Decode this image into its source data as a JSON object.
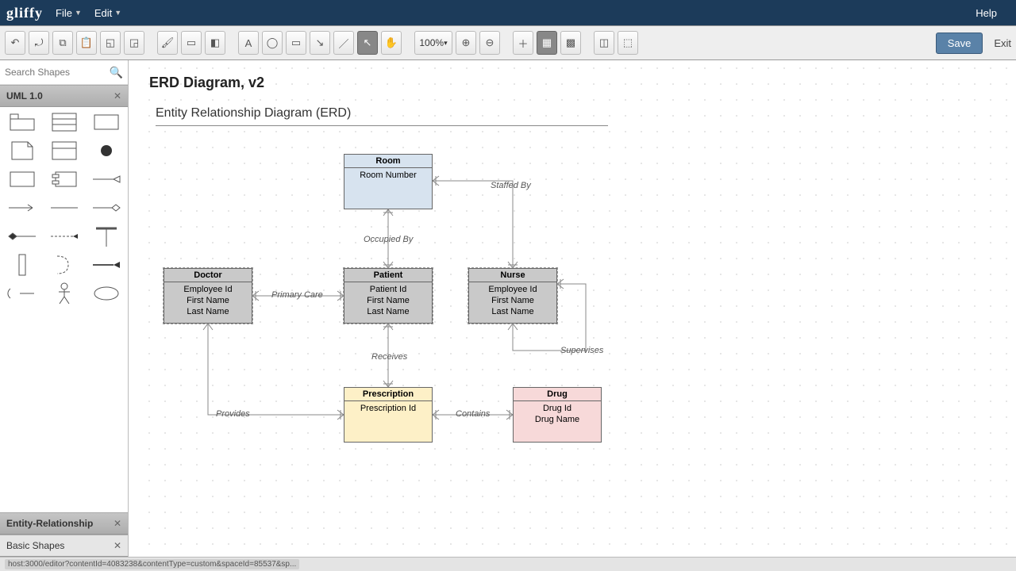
{
  "menubar": {
    "logo": "gliffy",
    "file": "File",
    "edit": "Edit",
    "help": "Help"
  },
  "toolbar": {
    "zoom": "100%",
    "save": "Save",
    "exit": "Exit"
  },
  "sidebar": {
    "search_placeholder": "Search Shapes",
    "panel_uml": "UML 1.0",
    "panel_er": "Entity-Relationship",
    "panel_basic": "Basic Shapes",
    "close": "✕"
  },
  "doc": {
    "title": "ERD Diagram, v2",
    "subtitle": "Entity Relationship Diagram (ERD)"
  },
  "entities": {
    "room": {
      "name": "Room",
      "attrs": "Room Number"
    },
    "doctor": {
      "name": "Doctor",
      "attrs": "Employee Id\nFirst Name\nLast Name"
    },
    "patient": {
      "name": "Patient",
      "attrs": "Patient Id\nFirst Name\nLast Name"
    },
    "nurse": {
      "name": "Nurse",
      "attrs": "Employee Id\nFirst Name\nLast Name"
    },
    "rx": {
      "name": "Prescription",
      "attrs": "Prescription Id"
    },
    "drug": {
      "name": "Drug",
      "attrs": "Drug Id\nDrug Name"
    }
  },
  "labels": {
    "staffed_by": "Staffed By",
    "occupied_by": "Occupied By",
    "primary_care": "Primary Care",
    "receives": "Receives",
    "supervises": "Supervises",
    "provides": "Provides",
    "contains": "Contains"
  },
  "status": {
    "url": "host:3000/editor?contentId=4083238&contentType=custom&spaceId=85537&sp..."
  }
}
